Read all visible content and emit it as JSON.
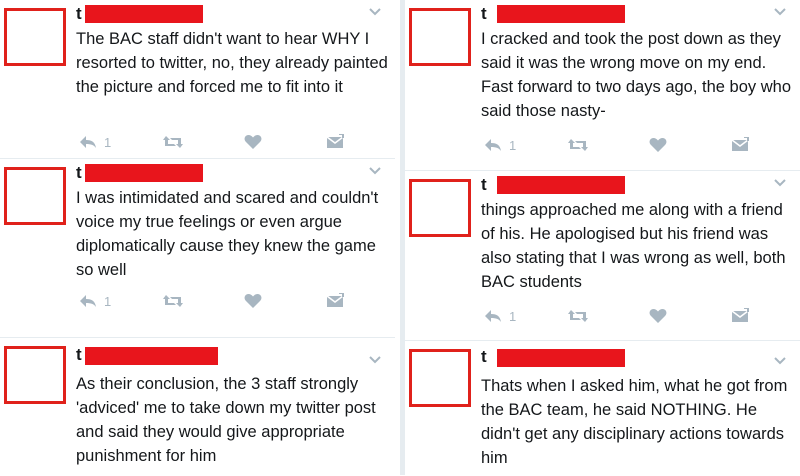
{
  "colors": {
    "redaction": "#e8151c",
    "avatar_border": "#e0211b",
    "icon": "#a8b6c1",
    "text": "#14171a"
  },
  "icons": [
    "reply-icon",
    "retweet-icon",
    "like-icon",
    "direct-message-icon",
    "chevron-down-icon"
  ],
  "left_column": [
    {
      "name_initial": "t",
      "text": "The BAC staff didn't want to hear WHY I resorted to twitter, no, they already painted the picture and forced me to fit into it",
      "reply_count": "1"
    },
    {
      "name_initial": "t",
      "text": "I was intimidated and scared and couldn't voice my true feelings or even argue diplomatically cause they knew the game so well",
      "reply_count": "1"
    },
    {
      "name_initial": "t",
      "text": "As their conclusion, the 3 staff strongly 'adviced' me to take down my twitter post and said they would give appropriate punishment for him",
      "reply_count": ""
    }
  ],
  "right_column": [
    {
      "name_initial": "t",
      "text": "I cracked and took the post down as they said it was the wrong move on my end. Fast forward to two days ago, the boy who said those nasty-",
      "reply_count": "1"
    },
    {
      "name_initial": "t",
      "text": "things approached me along with a friend of his. He apologised but his friend was also stating that I was wrong as well, both BAC students",
      "reply_count": "1"
    },
    {
      "name_initial": "t",
      "text": "Thats when I asked him, what he got from the BAC team, he said NOTHING. He didn't get any disciplinary actions towards him",
      "reply_count": ""
    }
  ]
}
